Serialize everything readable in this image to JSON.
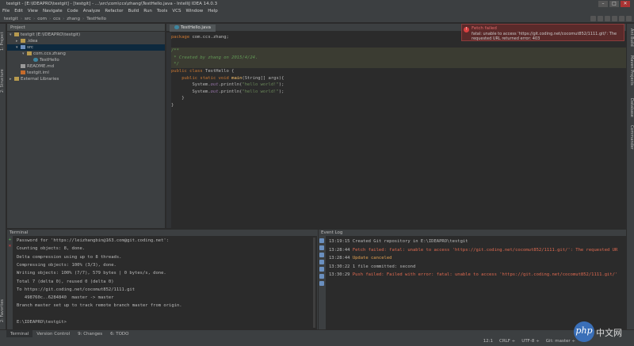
{
  "window": {
    "title": "testgit - [E:\\IDEAPRO\\testgit] - [testgit] - ...\\src\\com\\ccs\\zhang\\TestHello.java - IntelliJ IDEA 14.0.3",
    "controls": [
      "–",
      "□",
      "✕"
    ]
  },
  "menu": [
    "File",
    "Edit",
    "View",
    "Navigate",
    "Code",
    "Analyze",
    "Refactor",
    "Build",
    "Run",
    "Tools",
    "VCS",
    "Window",
    "Help"
  ],
  "breadcrumbs": [
    "testgit",
    "src",
    "com",
    "ccs",
    "zhang",
    "TestHello"
  ],
  "left_strip": [
    "1: Project",
    "2: Structure",
    "2: Favorites"
  ],
  "right_strip": [
    "Ant Build",
    "Maven Projects",
    "Database",
    "Commander"
  ],
  "project": {
    "header": "Project",
    "tree": [
      {
        "label": "testgit (E:\\IDEAPRO\\testgit)",
        "indent": 0,
        "arrow": "▾",
        "icon": "folder"
      },
      {
        "label": ".idea",
        "indent": 1,
        "arrow": "▸",
        "icon": "folder"
      },
      {
        "label": "src",
        "indent": 1,
        "arrow": "▾",
        "icon": "folder-blue",
        "selected": true
      },
      {
        "label": "com.ccs.zhang",
        "indent": 2,
        "arrow": "▾",
        "icon": "folder"
      },
      {
        "label": "TestHello",
        "indent": 3,
        "arrow": "",
        "icon": "class"
      },
      {
        "label": "README.md",
        "indent": 1,
        "arrow": "",
        "icon": "txt"
      },
      {
        "label": "testgit.iml",
        "indent": 1,
        "arrow": "",
        "icon": "xml"
      },
      {
        "label": "External Libraries",
        "indent": 0,
        "arrow": "▸",
        "icon": "folder"
      }
    ]
  },
  "editor": {
    "tab": "TestHello.java",
    "lines": [
      [
        {
          "t": "package ",
          "c": "kw"
        },
        {
          "t": "com.ccs.zhang;",
          "c": ""
        }
      ],
      [],
      [
        {
          "t": "/**",
          "c": "doc"
        }
      ],
      [
        {
          "t": " * Created by zhang on 2015/4/24.",
          "c": "doc"
        }
      ],
      [
        {
          "t": " */",
          "c": "doc"
        }
      ],
      [
        {
          "t": "public class ",
          "c": "kw"
        },
        {
          "t": "TestHello {",
          "c": ""
        }
      ],
      [
        {
          "t": "    public static void ",
          "c": "kw"
        },
        {
          "t": "main",
          "c": "fn"
        },
        {
          "t": "(String[] args){",
          "c": ""
        }
      ],
      [
        {
          "t": "        System.",
          "c": ""
        },
        {
          "t": "out",
          "c": "fld"
        },
        {
          "t": ".println(",
          "c": ""
        },
        {
          "t": "\"hello world!\"",
          "c": "str"
        },
        {
          "t": ");",
          "c": ""
        }
      ],
      [
        {
          "t": "        System.",
          "c": ""
        },
        {
          "t": "out",
          "c": "fld"
        },
        {
          "t": ".println(",
          "c": ""
        },
        {
          "t": "\"hello world!\"",
          "c": "str"
        },
        {
          "t": ");",
          "c": ""
        }
      ],
      [
        {
          "t": "    }",
          "c": ""
        }
      ],
      [
        {
          "t": "}",
          "c": ""
        }
      ]
    ]
  },
  "notification": {
    "title": "Fetch failed",
    "body": "fatal: unable to access 'https://git.coding.net/cocomut852/1111.git/': The requested URL returned error: 403"
  },
  "terminal": {
    "header": "Terminal",
    "lines": [
      "Password for 'https://leizhangbin@163.com@git.coding.net':",
      "Counting objects: 8, done.",
      "Delta compression using up to 8 threads.",
      "Compressing objects: 100% (3/3), done.",
      "Writing objects: 100% (7/7), 579 bytes | 0 bytes/s, done.",
      "Total 7 (delta 0), reused 0 (delta 0)",
      "To https://git.coding.net/cocomut852/1111.git",
      "   498760c..6284840  master -> master",
      "Branch master set up to track remote branch master from origin.",
      "",
      "E:\\IDEAPRO\\testgit>"
    ]
  },
  "eventlog": {
    "header": "Event Log",
    "entries": [
      {
        "time": "13:19:15",
        "text": "Created Git repository in E:\\IDEAPRO\\testgit",
        "level": "ok"
      },
      {
        "time": "13:28:44",
        "text": "Fetch failed: fatal: unable to access 'https://git.coding.net/cocomut852/1111.git/': The requested UR",
        "level": "err"
      },
      {
        "time": "13:28:44",
        "text": "Update canceled",
        "level": "warn"
      },
      {
        "time": "13:30:22",
        "text": "1 file committed: second",
        "level": "ok"
      },
      {
        "time": "13:30:29",
        "text": "Push failed: Failed with error: fatal: unable to access 'https://git.coding.net/cocomut852/1111.git/'",
        "level": "err"
      }
    ]
  },
  "bottom_tabs": [
    "Terminal",
    "Version Control",
    "9: Changes",
    "6: TODO"
  ],
  "status": [
    "12:1",
    "CRLF ÷",
    "UTF-8 ÷",
    "Git: master ÷"
  ],
  "watermark": {
    "logo": "php",
    "text": "中文网"
  }
}
